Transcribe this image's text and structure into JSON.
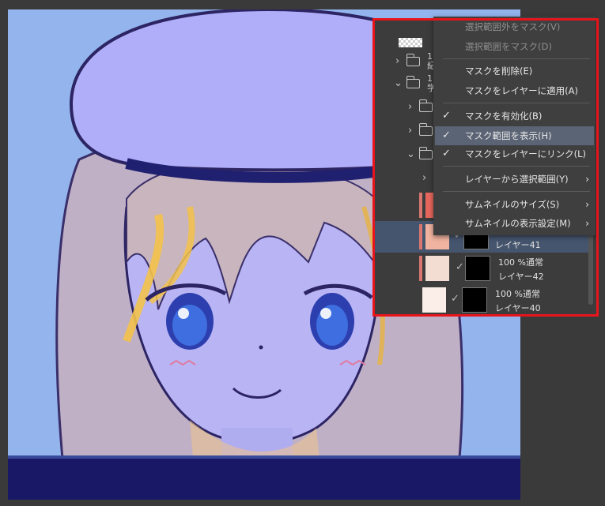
{
  "context_menu": {
    "items": [
      {
        "label": "選択範囲外をマスク(V)",
        "enabled": false,
        "checked": false,
        "submenu": false
      },
      {
        "label": "選択範囲をマスク(D)",
        "enabled": false,
        "checked": false,
        "submenu": false
      },
      {
        "label": "マスクを削除(E)",
        "enabled": true,
        "checked": false,
        "submenu": false
      },
      {
        "label": "マスクをレイヤーに適用(A)",
        "enabled": true,
        "checked": false,
        "submenu": false
      },
      {
        "label": "マスクを有効化(B)",
        "enabled": true,
        "checked": true,
        "submenu": false
      },
      {
        "label": "マスク範囲を表示(H)",
        "enabled": true,
        "checked": true,
        "submenu": false,
        "highlighted": true
      },
      {
        "label": "マスクをレイヤーにリンク(L)",
        "enabled": true,
        "checked": true,
        "submenu": false
      },
      {
        "label": "レイヤーから選択範囲(Y)",
        "enabled": true,
        "checked": false,
        "submenu": true
      },
      {
        "label": "サムネイルのサイズ(S)",
        "enabled": true,
        "checked": false,
        "submenu": true
      },
      {
        "label": "サムネイルの表示設定(M)",
        "enabled": true,
        "checked": false,
        "submenu": true
      }
    ],
    "check_glyph": "✓",
    "submenu_glyph": "›"
  },
  "layer_panel": {
    "folder_rows": [
      {
        "name_partial": "1",
        "name_partial_2": "紀"
      },
      {
        "name_partial": "1",
        "name_partial_2": "学"
      }
    ],
    "layers": [
      {
        "blend": "",
        "name": "レイヤー41",
        "thumb_color": "#f0b4a0",
        "selected": true,
        "mask": true
      },
      {
        "blend": "100 %通常",
        "name": "レイヤー42",
        "thumb_color": "#f3ddd2",
        "selected": false,
        "mask": true
      },
      {
        "blend": "100 %通常",
        "name": "レイヤー40",
        "thumb_color": "#fbeee8",
        "selected": false,
        "mask": true
      }
    ]
  },
  "colors": {
    "highlight_border": "#e8141c",
    "menu_bg": "#3f3f3f",
    "menu_highlight": "#5b6474",
    "canvas_bg": "#93b4ec"
  }
}
